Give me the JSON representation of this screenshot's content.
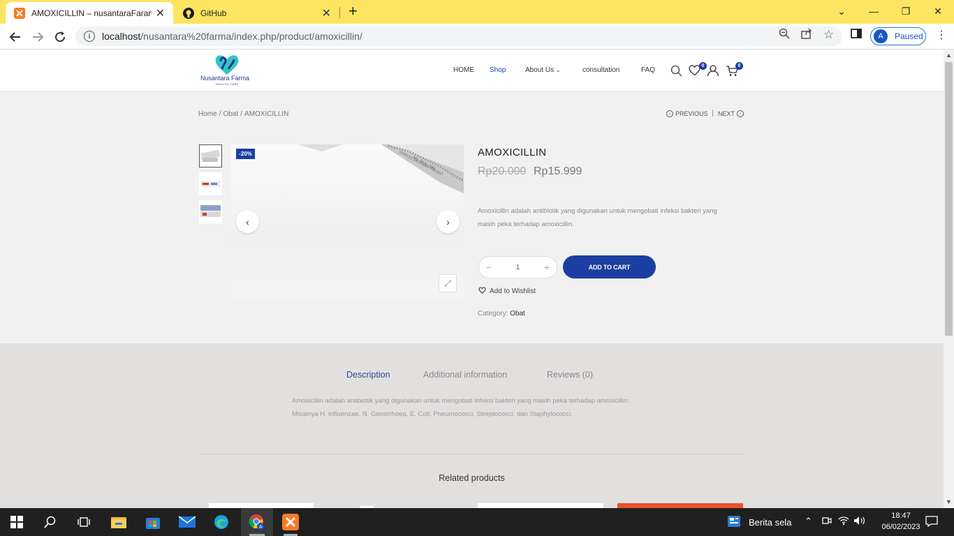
{
  "browser": {
    "tabs": [
      {
        "title": "AMOXICILLIN – nusantaraFarama",
        "active": true
      },
      {
        "title": "GitHub",
        "active": false
      }
    ],
    "url_host": "localhost",
    "url_path": "/nusantara%20farma/index.php/product/amoxicillin/",
    "profile_initial": "A",
    "profile_status": "Paused"
  },
  "site": {
    "logo_name": "Nusantara Farma",
    "logo_tagline": "HEALTH CARE",
    "menu": [
      "HOME",
      "Shop",
      "About Us",
      "consultation",
      "FAQ"
    ],
    "wishlist_count": "0",
    "cart_count": "0"
  },
  "breadcrumb": {
    "home": "Home",
    "category": "Obat",
    "current": "AMOXICILLIN"
  },
  "pager": {
    "previous": "PREVIOUS",
    "next": "NEXT"
  },
  "product": {
    "name": "AMOXICILLIN",
    "old_price": "Rp20.000",
    "price": "Rp15.999",
    "sale_badge": "-20%",
    "short_desc": "Amoxicillin adalah antibiotik yang digunakan untuk mengobati infeksi bakteri yang masih peka terhadap amoxicillin.",
    "quantity": "1",
    "add_to_cart": "ADD TO CART",
    "wishlist": "Add to Wishlist",
    "category_label": "Category:",
    "category": "Obat"
  },
  "product_tabs": {
    "tabs": [
      "Description",
      "Additional information",
      "Reviews (0)"
    ],
    "description": "Amoxicillin adalah antibiotik yang digunakan untuk mengobati infeksi bakteri yang masih peka terhadap amoxicillin. Misalnya H. influenzae, N. Gonorrhoea, E. Coli, Pneumococci, Streptococci, dan Staphylococci.",
    "related_title": "Related products"
  },
  "taskbar": {
    "news": "Berita sela",
    "time": "18:47",
    "date": "06/02/2023"
  },
  "colors": {
    "accent": "#1b3fa0",
    "chrome": "#fde561",
    "taskbar": "#202020"
  }
}
